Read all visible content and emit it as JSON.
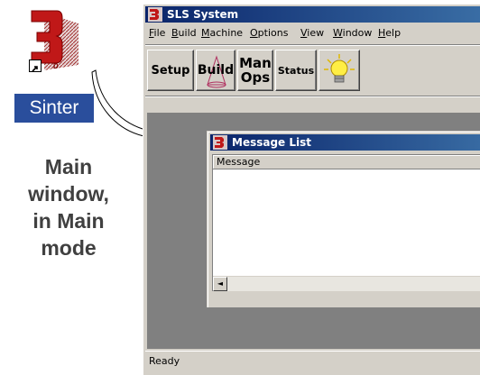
{
  "shortcut": {
    "label": "Sinter",
    "icon": "3d-logo-icon"
  },
  "caption": {
    "line1": "Main",
    "line2": "window,",
    "line3": "in Main",
    "line4": "mode"
  },
  "app": {
    "title": "SLS System",
    "menu": [
      {
        "accel": "F",
        "rest": "ile"
      },
      {
        "accel": "B",
        "rest": "uild"
      },
      {
        "accel": "M",
        "rest": "achine"
      },
      {
        "accel": "O",
        "rest": "ptions"
      },
      {
        "accel": "V",
        "rest": "iew"
      },
      {
        "accel": "W",
        "rest": "indow"
      },
      {
        "accel": "H",
        "rest": "elp"
      }
    ],
    "toolbar": {
      "setup": "Setup",
      "build": "Build",
      "manops_line1": "Man",
      "manops_line2": "Ops",
      "status": "Status",
      "lightbulb": "lightbulb-icon"
    },
    "child": {
      "title": "Message List",
      "column_header": "Message",
      "scroll_left": "◄"
    },
    "statusbar": "Ready"
  },
  "colors": {
    "titlebar": "#0a246a",
    "client_bg": "#808080",
    "chrome": "#d4d0c8",
    "shortcut_label_bg": "#2a4e9c"
  }
}
